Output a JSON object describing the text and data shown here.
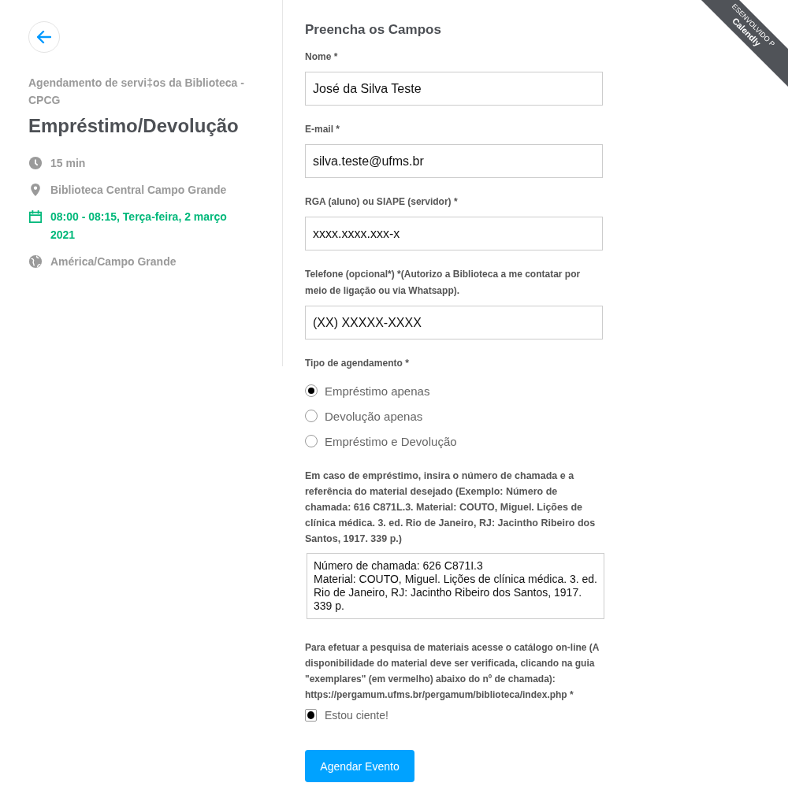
{
  "event": {
    "organizer": "Agendamento de servi‡os da Biblioteca - CPCG",
    "title": "Empréstimo/Devolução",
    "details": [
      {
        "kind": "duration",
        "text": "15 min"
      },
      {
        "kind": "location",
        "text": "Biblioteca Central Campo Grande"
      },
      {
        "kind": "datetime",
        "text": "08:00 - 08:15, Terça-feira, 2 março 2021"
      },
      {
        "kind": "timezone",
        "text": "América/Campo Grande"
      }
    ]
  },
  "form": {
    "heading": "Preencha os Campos",
    "fields": [
      {
        "label": "Nome *",
        "value": "José da Silva Teste"
      },
      {
        "label": "E-mail *",
        "value": "silva.teste@ufms.br"
      },
      {
        "label": "RGA (aluno) ou SIAPE (servidor) *",
        "value": "xxxx.xxxx.xxx-x"
      },
      {
        "label": "Telefone (opcional*) *(Autorizo a Biblioteca a me contatar por meio de ligação ou via Whatsapp).",
        "value": "(XX) XXXXX-XXXX"
      }
    ],
    "type_question": {
      "label": "Tipo de agendamento *",
      "options": [
        {
          "label": "Empréstimo apenas",
          "selected": true
        },
        {
          "label": "Devolução apenas",
          "selected": false
        },
        {
          "label": "Empréstimo e Devolução",
          "selected": false
        }
      ]
    },
    "material_question": {
      "label": "Em caso de empréstimo, insira o número de chamada e a referência do material desejado (Exemplo: Número de chamada: 616 C871L.3. Material: COUTO, Miguel. Lições de clínica médica. 3. ed. Rio de Janeiro, RJ: Jacintho Ribeiro dos Santos, 1917. 339 p.)",
      "value": "Número de chamada: 626 C871I.3\nMaterial: COUTO, Miguel. Lições de clínica médica. 3. ed. Rio de Janeiro, RJ: Jacintho Ribeiro dos Santos, 1917. 339 p."
    },
    "catalog_question": {
      "label": "Para efetuar a pesquisa de materiais acesse o catálogo on-line (A disponibilidade do material deve ser verificada, clicando na guia \"exemplares\" (em vermelho) abaixo do nº de chamada): https://pergamum.ufms.br/pergamum/biblioteca/index.php *",
      "option": "Estou ciente!",
      "checked": true
    },
    "submit": "Agendar Evento"
  },
  "ribbon": {
    "caption": "ESENVOLVIDO P",
    "brand": "Calendly"
  }
}
